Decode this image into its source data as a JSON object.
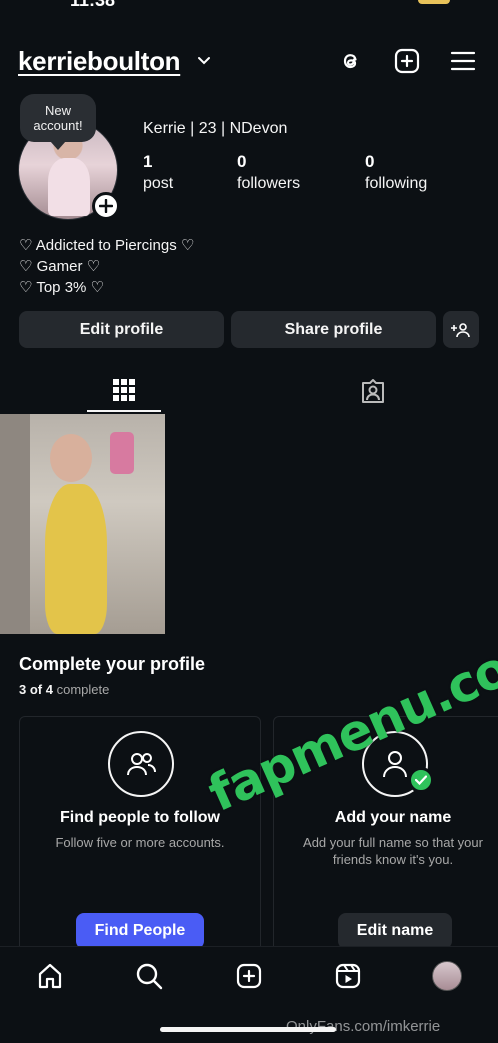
{
  "status_bar": {
    "time": "11:38"
  },
  "header": {
    "username": "kerrieboulton",
    "icons": [
      "threads-icon",
      "create-icon",
      "menu-icon"
    ]
  },
  "profile": {
    "bubble_text": "New account!",
    "display_name": "Kerrie | 23 | NDevon",
    "stats": [
      {
        "value": "1",
        "label": "post"
      },
      {
        "value": "0",
        "label": "followers"
      },
      {
        "value": "0",
        "label": "following"
      }
    ],
    "bio": [
      "♡ Addicted to Piercings ♡",
      "♡ Gamer ♡",
      "♡ Top 3% ♡"
    ]
  },
  "actions": {
    "edit_label": "Edit profile",
    "share_label": "Share profile"
  },
  "complete_profile": {
    "title": "Complete your profile",
    "progress": "3 of 4",
    "progress_suffix": "complete",
    "cards": [
      {
        "title": "Find people to follow",
        "description": "Follow five or more accounts.",
        "button": "Find People"
      },
      {
        "title": "Add your name",
        "description": "Add your full name so that your friends know it's you.",
        "button": "Edit name"
      }
    ]
  },
  "overlay": {
    "watermark": "fapmenu.com",
    "credit": "OnlyFans.com/imkerrie"
  },
  "colors": {
    "background": "#0c1014",
    "accent_button": "#4a5cf5",
    "check_green": "#2fc25b"
  }
}
